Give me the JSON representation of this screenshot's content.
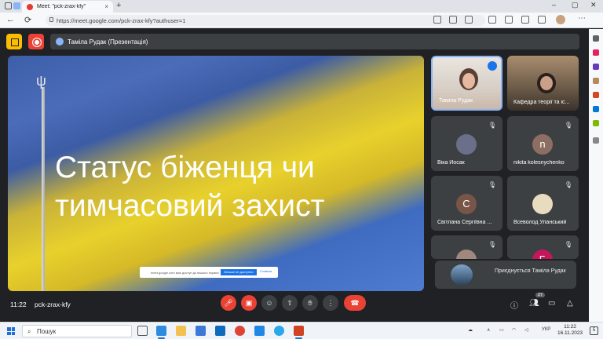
{
  "browser": {
    "tab_title": "Meet: \"pck-zrax-kfy\"",
    "tab_close": "×",
    "new_tab": "+",
    "url": "https://meet.google.com/pck-zrax-kfy?authuser=1",
    "back": "←",
    "reload": "⟳",
    "more": "⋯",
    "minimize": "–",
    "maximize": "▢",
    "close": "✕"
  },
  "meet": {
    "presenter_banner": "Таміла Рудак (Презентація)",
    "slide_title_line1": "Статус біженця чи",
    "slide_title_line2": "тимчасовий захист",
    "cookie_text": "meet.google.com має доступ до вашого екрана",
    "cookie_ok": "Більше не доступно",
    "cookie_more": "Сховати",
    "participants": [
      {
        "name": "Таміла Рудак",
        "muted": false
      },
      {
        "name": "Кафедра теорії та іс...",
        "muted": false
      },
      {
        "name": "Віка Йосак",
        "muted": true
      },
      {
        "name": "nikita kolesnychenko",
        "initial": "n",
        "color": "#8d6e63",
        "muted": true
      },
      {
        "name": "Світлана Сергіївна ...",
        "initial": "С",
        "color": "#795548",
        "muted": true
      },
      {
        "name": "Всеволод Уланський",
        "muted": true
      },
      {
        "name": "",
        "muted": true
      },
      {
        "name": "",
        "initial": "Б",
        "color": "#c2185b",
        "muted": true
      }
    ],
    "join_notice": "Приєднується Таміла Рудак",
    "time": "11:22",
    "meeting_code": "pck-zrax-kfy",
    "people_count": "27",
    "mute_glyph": "🎙",
    "colors": {
      "accent": "#8ab4f8",
      "danger": "#ea4335",
      "surface": "#3c4043",
      "background": "#202124"
    }
  },
  "taskbar": {
    "search_placeholder": "Пошук",
    "language": "УКР",
    "time": "11:22",
    "date": "16.11.2023",
    "notifications": "5"
  }
}
